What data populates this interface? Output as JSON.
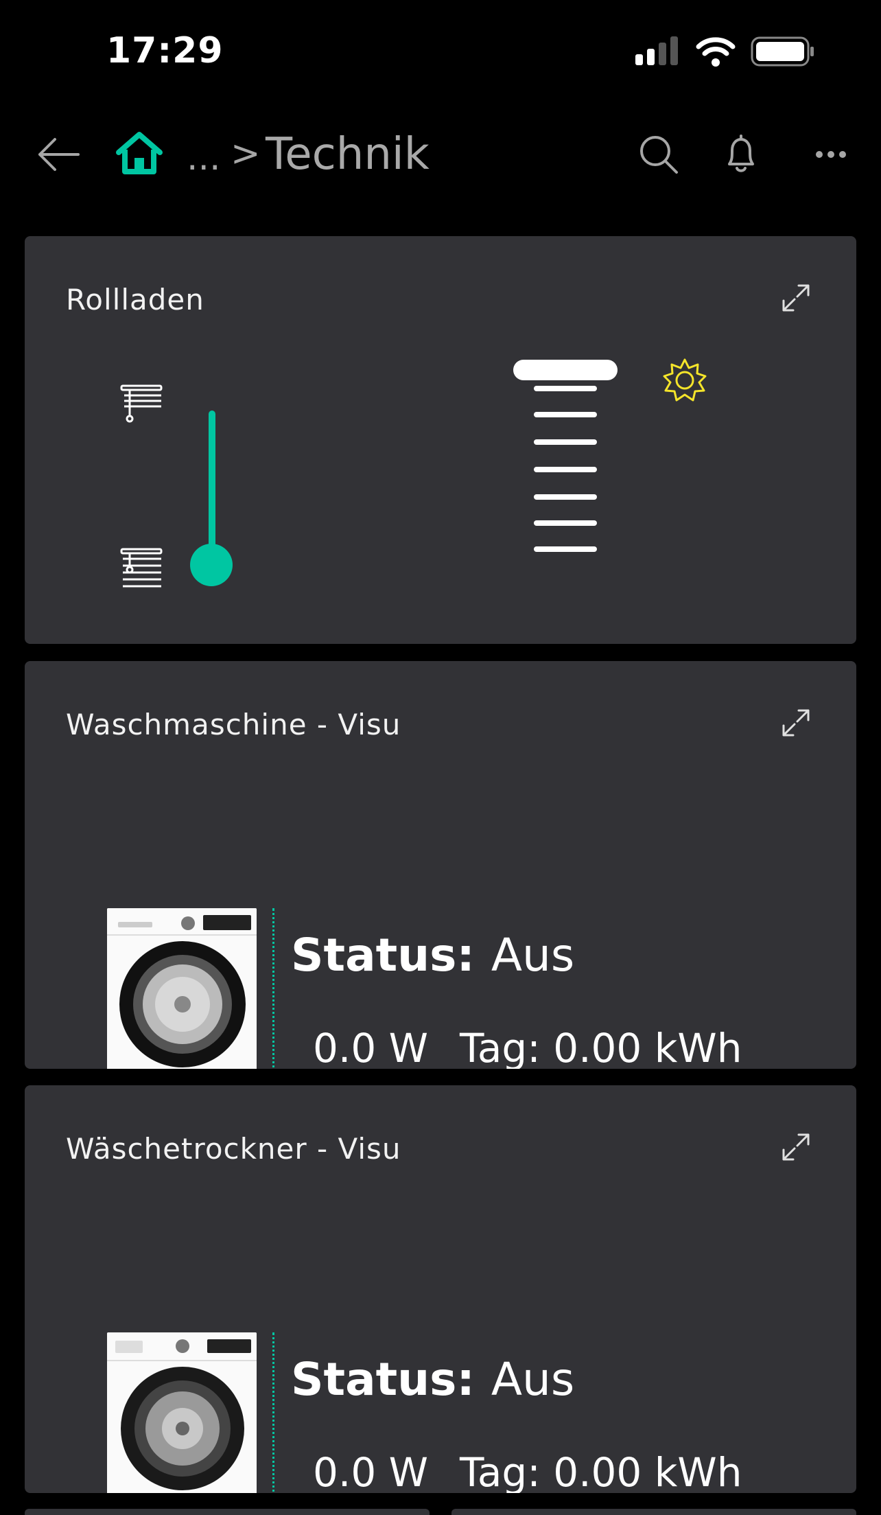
{
  "status_bar": {
    "time": "17:29"
  },
  "nav": {
    "breadcrumb_ellipsis": "...",
    "breadcrumb_separator": ">",
    "title": "Technik",
    "accent_color": "#00c6a2"
  },
  "cards": {
    "rollladen": {
      "title": "Rollladen"
    },
    "waschmaschine": {
      "title": "Waschmaschine - Visu",
      "status_label": "Status:",
      "status_value": "Aus",
      "power": "0.0 W",
      "day_energy": "Tag: 0.00 kWh"
    },
    "trockner": {
      "title": "Wäschetrockner - Visu",
      "status_label": "Status:",
      "status_value": "Aus",
      "power": "0.0 W",
      "day_energy": "Tag: 0.00 kWh"
    }
  },
  "icons": {
    "back": "arrow-left-icon",
    "home": "home-icon",
    "search": "search-icon",
    "notifications": "bell-icon",
    "more": "more-icon",
    "expand": "expand-icon",
    "sun": "sun-icon"
  },
  "colors": {
    "background": "#000000",
    "card": "#323236",
    "accent": "#00c6a2",
    "sun": "#f5e52a"
  }
}
